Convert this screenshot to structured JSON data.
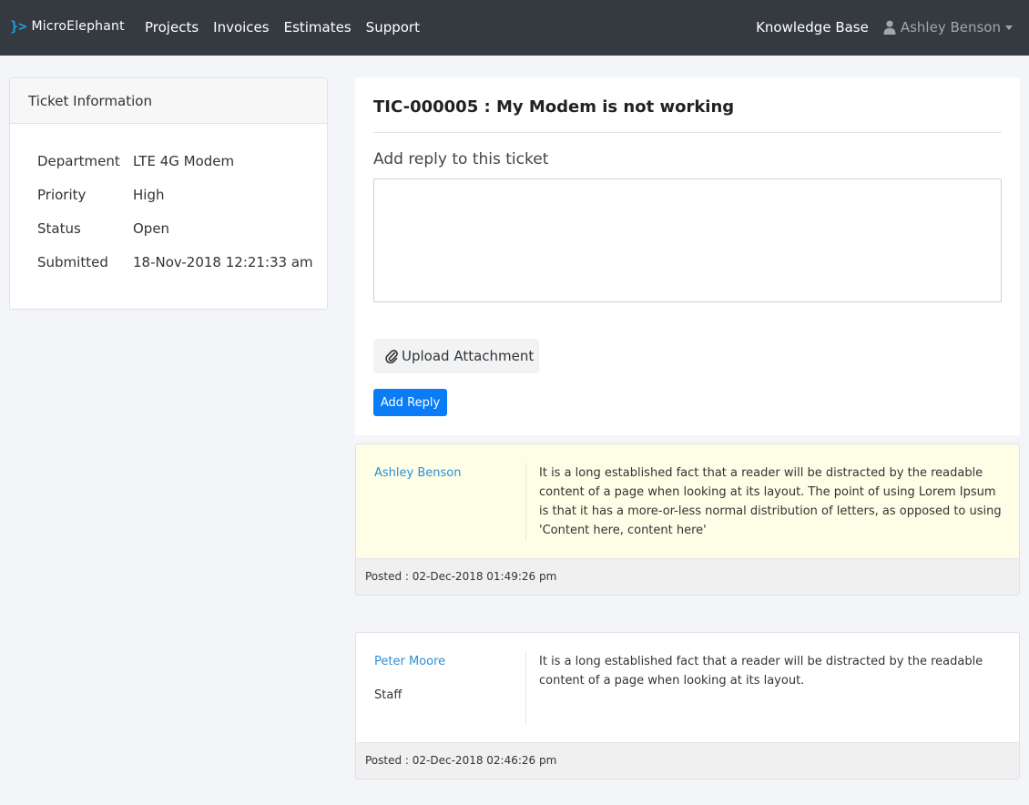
{
  "navbar": {
    "brand": "MicroElephant",
    "brand_mark": "}>",
    "links": [
      "Projects",
      "Invoices",
      "Estimates",
      "Support"
    ],
    "knowledge_base": "Knowledge Base",
    "user_name": "Ashley Benson"
  },
  "ticket_info": {
    "header": "Ticket Information",
    "rows": [
      {
        "label": "Department",
        "value": "LTE 4G Modem"
      },
      {
        "label": "Priority",
        "value": "High"
      },
      {
        "label": "Status",
        "value": "Open"
      },
      {
        "label": "Submitted",
        "value": "18-Nov-2018 12:21:33 am"
      }
    ]
  },
  "ticket": {
    "title": "TIC-000005 : My Modem is not working",
    "reply_label": "Add reply to this ticket",
    "reply_value": "",
    "upload_label": "Upload Attachment",
    "add_reply_label": "Add Reply"
  },
  "replies": [
    {
      "author": "Ashley Benson",
      "role": "",
      "text": "It is a long established fact that a reader will be distracted by the readable content of a page when looking at its layout. The point of using Lorem Ipsum is that it has a more-or-less normal distribution of letters, as opposed to using 'Content here, content here'",
      "posted": "Posted : 02-Dec-2018 01:49:26 pm"
    },
    {
      "author": "Peter Moore",
      "role": "Staff",
      "text": "It is a long established fact that a reader will be distracted by the readable content of a page when looking at its layout.",
      "posted": "Posted : 02-Dec-2018 02:46:26 pm"
    }
  ],
  "colors": {
    "navbar_bg": "#343a40",
    "accent": "#0a7cf5",
    "link": "#2a8fd8",
    "highlight_reply_bg": "#fefee6"
  }
}
